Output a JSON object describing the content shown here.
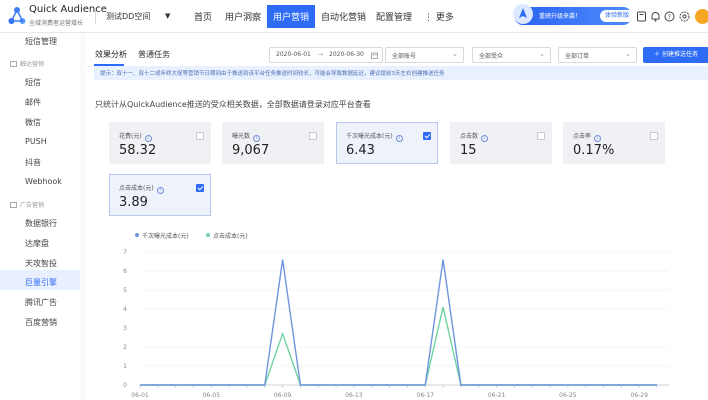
{
  "app": {
    "title": "Quick Audience",
    "subtitle": "全域消费者运营增长",
    "workspace": "测试DD空间"
  },
  "nav": {
    "items": [
      {
        "label": "首页",
        "active": false
      },
      {
        "label": "用户洞察",
        "active": false
      },
      {
        "label": "用户营销",
        "active": true
      },
      {
        "label": "自动化营销",
        "active": false
      },
      {
        "label": "配置管理",
        "active": false
      },
      {
        "label": "⋮ 更多",
        "active": false
      }
    ]
  },
  "notice": {
    "text": "重磅升级来袭！",
    "button": "体验新版"
  },
  "top_icons": [
    "book-icon",
    "bell-icon",
    "help-icon",
    "settings-icon",
    "user-icon"
  ],
  "sidebar": {
    "items_top": [
      {
        "label": "短信管理"
      }
    ],
    "group1": "触达营销",
    "group1_items": [
      {
        "label": "短信"
      },
      {
        "label": "邮件"
      },
      {
        "label": "微信"
      },
      {
        "label": "PUSH"
      },
      {
        "label": "抖音"
      },
      {
        "label": "Webhook"
      }
    ],
    "group2": "广告营销",
    "group2_items": [
      {
        "label": "数据银行"
      },
      {
        "label": "达摩盘"
      },
      {
        "label": "天攻智投"
      },
      {
        "label": "巨量引擎"
      },
      {
        "label": "腾讯广告"
      },
      {
        "label": "百度营销"
      }
    ],
    "active_label": "巨量引擎"
  },
  "tabs": [
    {
      "label": "效果分析",
      "active": true
    },
    {
      "label": "普通任务",
      "active": false
    }
  ],
  "filters": {
    "date_start": "2020-06-01",
    "date_sep": "→",
    "date_end": "2020-06-30",
    "account": "全部账号",
    "audience": "全部受众",
    "order": "全部订单",
    "create_button": "＋ 创建推送任务"
  },
  "hint": "提示：双十一、双十二或年终大促等营销节日期间由于推送到该平台任务推送时间较长，可能会导致数据延迟，建议提前3天左右创建推送任务",
  "intro": "只统计从QuickAudience推送的受众相关数据，全部数据请登录对应平台查看",
  "metrics": [
    {
      "label": "花费(元)",
      "value": "58.32",
      "checked": false
    },
    {
      "label": "曝光数",
      "value": "9,067",
      "checked": false
    },
    {
      "label": "千次曝光成本(元)",
      "value": "6.43",
      "checked": true
    },
    {
      "label": "点击数",
      "value": "15",
      "checked": false
    },
    {
      "label": "点击率",
      "value": "0.17%",
      "checked": false
    },
    {
      "label": "点击成本(元)",
      "value": "3.89",
      "checked": true
    }
  ],
  "chart_data": {
    "type": "line",
    "x": [
      "06-01",
      "06-02",
      "06-03",
      "06-04",
      "06-05",
      "06-06",
      "06-07",
      "06-08",
      "06-09",
      "06-10",
      "06-11",
      "06-12",
      "06-13",
      "06-14",
      "06-15",
      "06-16",
      "06-17",
      "06-18",
      "06-19",
      "06-20",
      "06-21",
      "06-22",
      "06-23",
      "06-24",
      "06-25",
      "06-26",
      "06-27",
      "06-28",
      "06-29",
      "06-30"
    ],
    "x_tick_labels": [
      "06-01",
      "06-05",
      "06-09",
      "06-13",
      "06-17",
      "06-21",
      "06-25",
      "06-29"
    ],
    "ylim": [
      0,
      7
    ],
    "yticks": [
      0,
      1,
      2,
      3,
      4,
      5,
      6,
      7
    ],
    "grid": true,
    "legend_position": "top-left",
    "series": [
      {
        "name": "千次曝光成本(元)",
        "color": "#6e95dd",
        "values": [
          0,
          0,
          0,
          0,
          0,
          0,
          0,
          0,
          6.6,
          0,
          0,
          0,
          0,
          0,
          0,
          0,
          0,
          6.6,
          0,
          0,
          0,
          0,
          0,
          0,
          0,
          0,
          0,
          0,
          0,
          0
        ]
      },
      {
        "name": "点击成本(元)",
        "color": "#6fd3a0",
        "values": [
          0,
          0,
          0,
          0,
          0,
          0,
          0,
          0,
          2.7,
          0,
          0,
          0,
          0,
          0,
          0,
          0,
          0,
          4.1,
          0,
          0,
          0,
          0,
          0,
          0,
          0,
          0,
          0,
          0,
          0,
          0
        ]
      }
    ]
  }
}
